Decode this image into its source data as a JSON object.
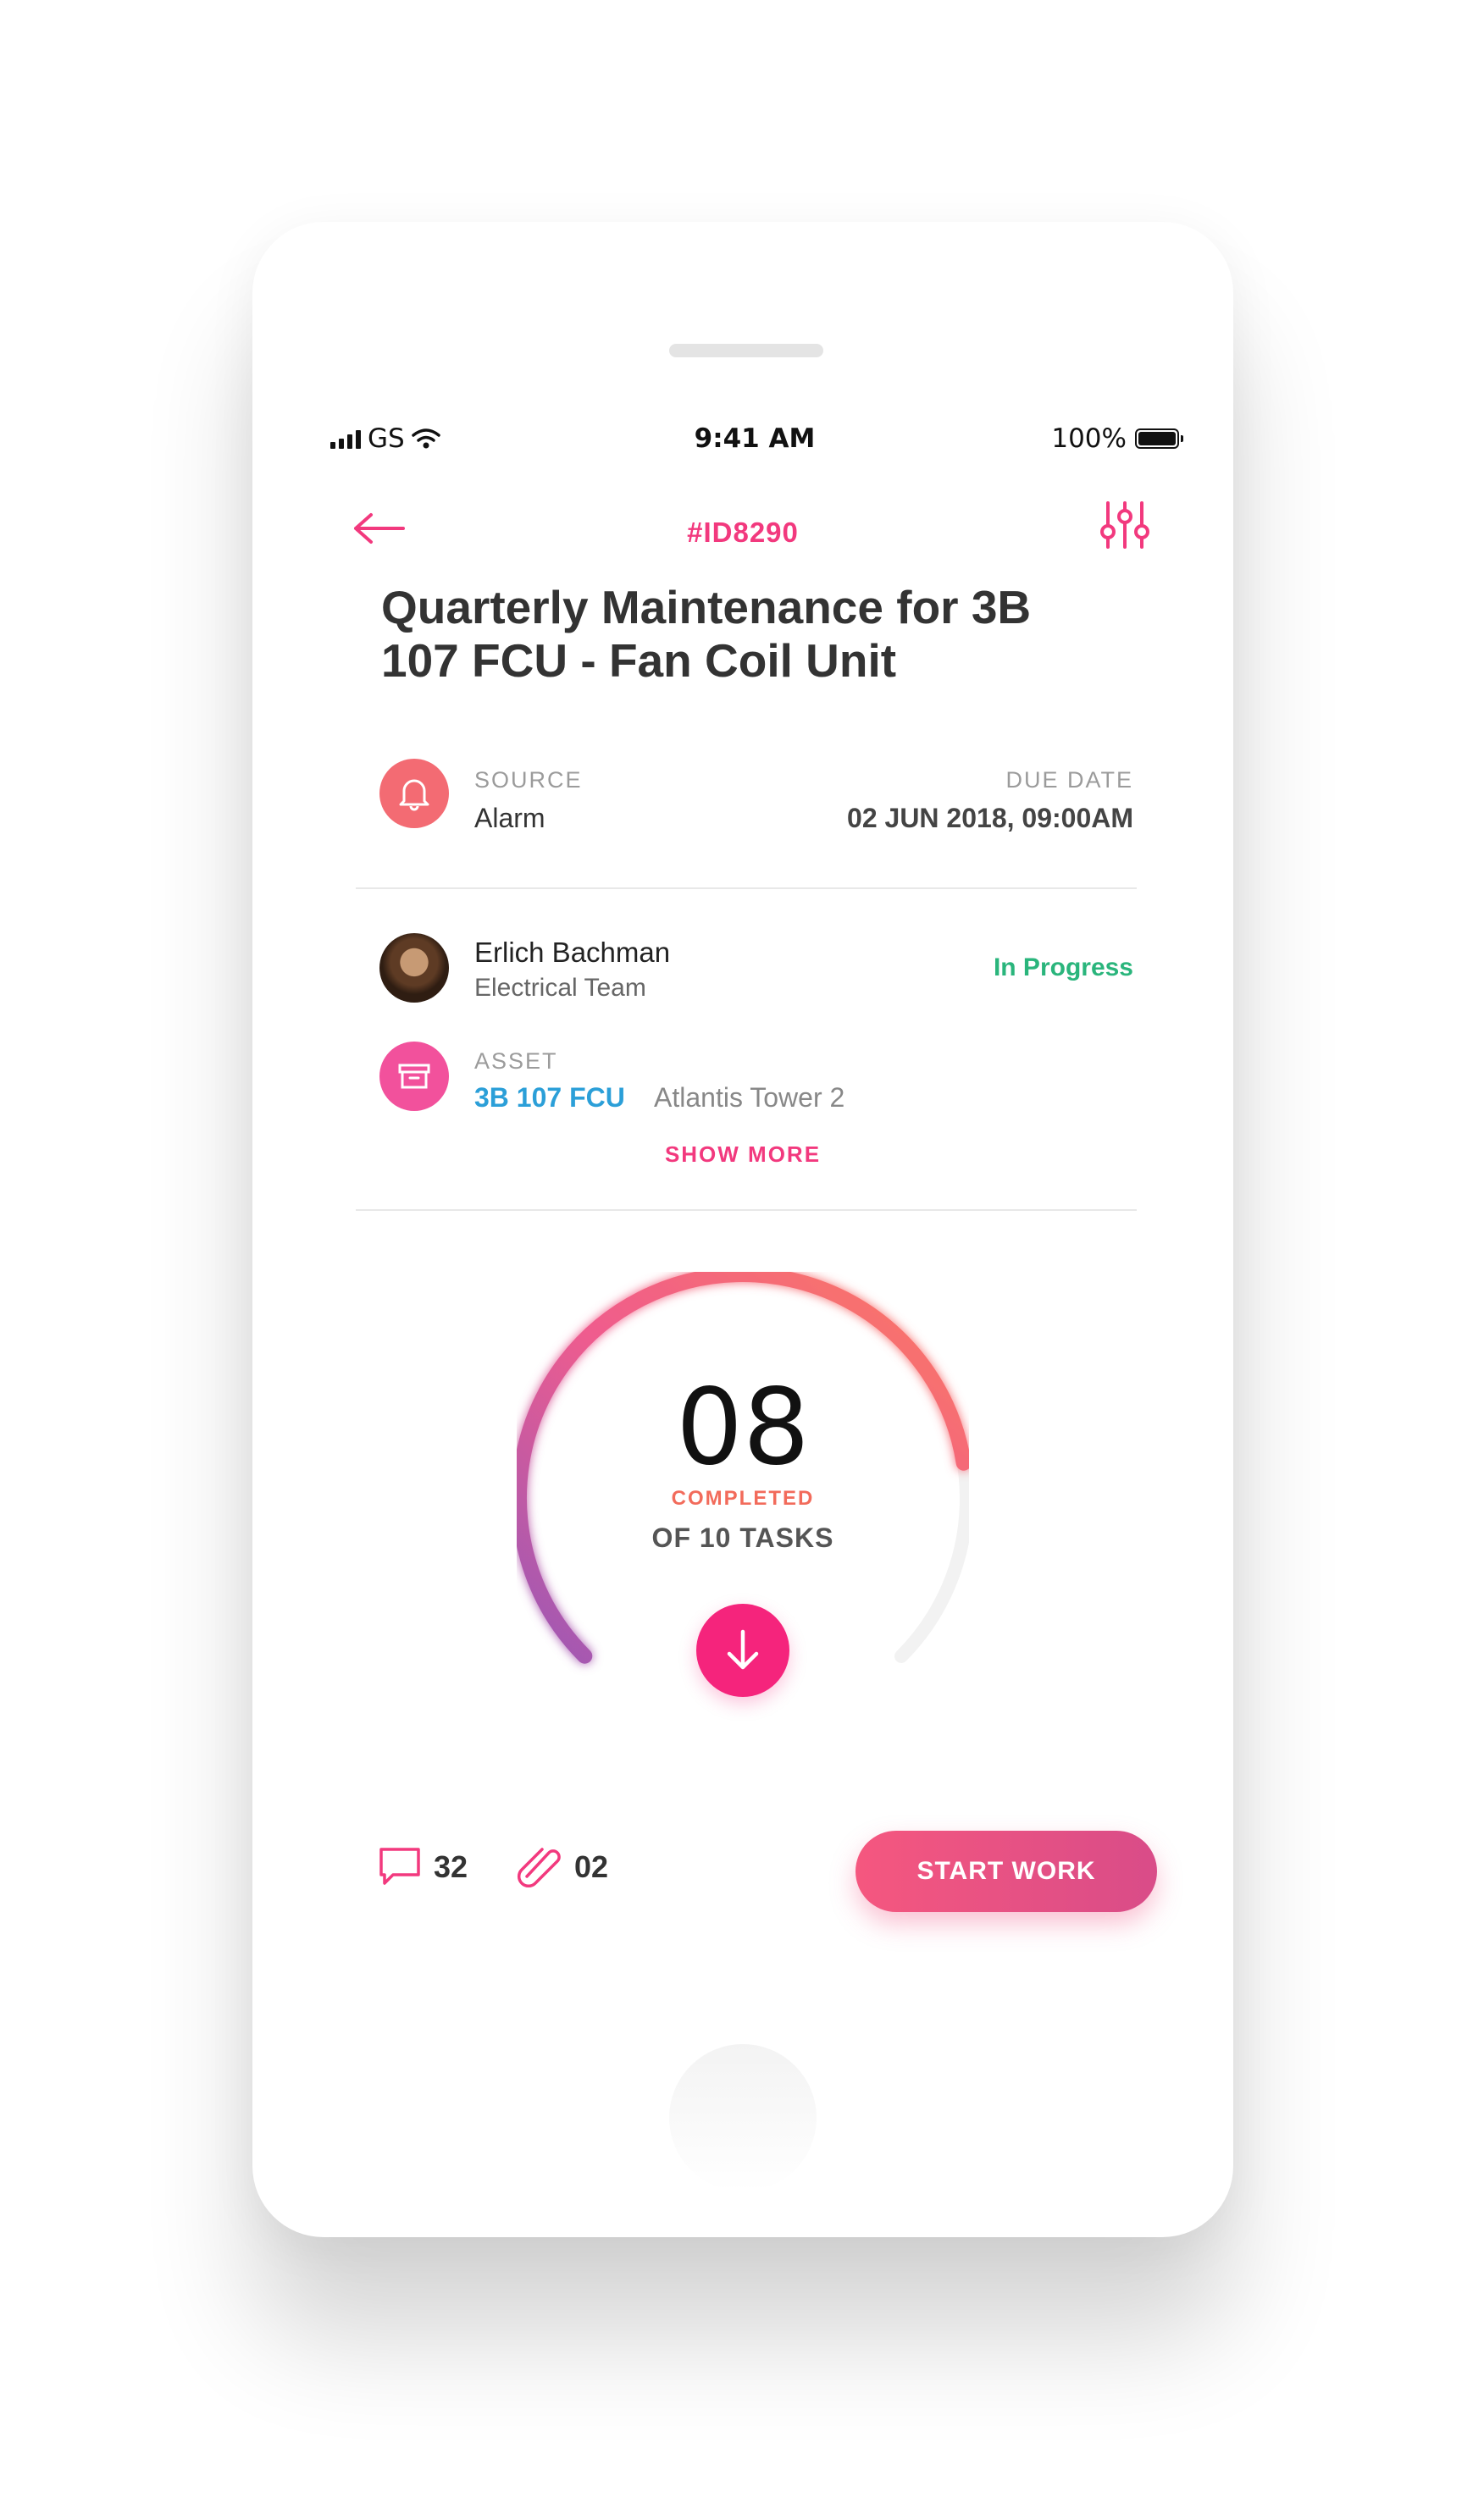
{
  "status_bar": {
    "carrier": "GS",
    "time": "9:41 AM",
    "battery": "100%"
  },
  "header": {
    "ticket_id": "#ID8290"
  },
  "title": "Quarterly Maintenance for 3B 107 FCU - Fan Coil Unit",
  "source": {
    "label": "SOURCE",
    "value": "Alarm"
  },
  "due_date": {
    "label": "DUE DATE",
    "value": "02 JUN 2018, 09:00AM"
  },
  "assignee": {
    "name": "Erlich Bachman",
    "team": "Electrical Team",
    "status": "In Progress"
  },
  "asset": {
    "label": "ASSET",
    "code": "3B 107 FCU",
    "location": "Atlantis Tower 2"
  },
  "show_more": "SHOW MORE",
  "progress": {
    "completed_count": "08",
    "completed_label": "COMPLETED",
    "total_label": "OF 10 TASKS",
    "completed": 8,
    "total": 10
  },
  "footer": {
    "comments_count": "32",
    "attachments_count": "02",
    "start_button": "START WORK"
  },
  "colors": {
    "accent": "#f2397e",
    "status_green": "#2ab57c",
    "link_blue": "#2b9fd8"
  }
}
